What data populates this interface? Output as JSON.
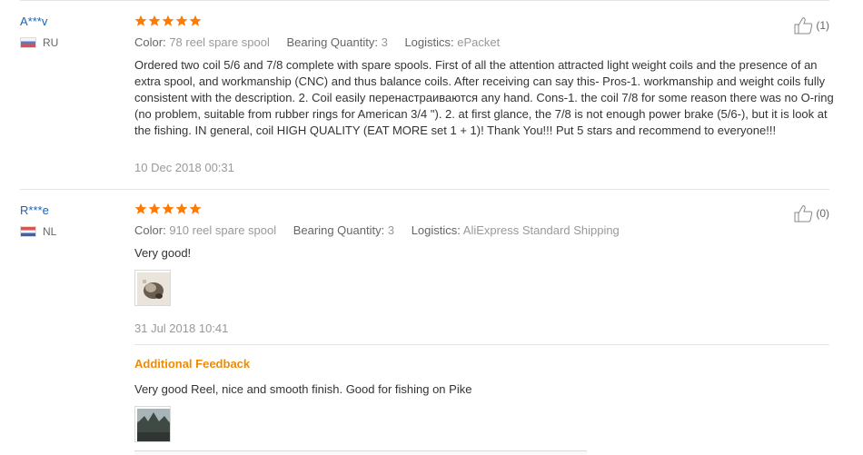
{
  "reviews": [
    {
      "user": "A***v",
      "country": "RU",
      "rating": 5,
      "attributes": [
        {
          "label": "Color:",
          "value": "78 reel spare spool"
        },
        {
          "label": "Bearing Quantity:",
          "value": "3"
        },
        {
          "label": "Logistics:",
          "value": "ePacket"
        }
      ],
      "text": "Ordered two coil 5/6 and 7/8 complete with spare spools. First of all the attention attracted light weight coils and the presence of an extra spool, and workmanship (CNC) and thus balance coils. After receiving can say this- Pros-1. workmanship and weight coils fully consistent with the description. 2. Coil easily перенастраиваются any hand. Cons-1. the coil 7/8 for some reason there was no O-ring (no problem, suitable from rubber rings for American 3/4 \"). 2. at first glance, the 7/8 is not enough power brake (5/6-), but it is look at the fishing. IN general, coil HIGH QUALITY (EAT MORE set 1 + 1)! Thank You!!! Put 5 stars and recommend to everyone!!!",
      "date": "10 Dec 2018 00:31",
      "helpful": "(1)"
    },
    {
      "user": "R***e",
      "country": "NL",
      "rating": 5,
      "attributes": [
        {
          "label": "Color:",
          "value": "910 reel spare spool"
        },
        {
          "label": "Bearing Quantity:",
          "value": "3"
        },
        {
          "label": "Logistics:",
          "value": "AliExpress Standard Shipping"
        }
      ],
      "text": "Very good!",
      "date": "31 Jul 2018 10:41",
      "helpful": "(0)",
      "additional": {
        "title": "Additional Feedback",
        "text": "Very good Reel, nice and smooth finish. Good for fishing on Pike"
      }
    }
  ],
  "colors": {
    "user_link": "#1a63b8",
    "star": "#ff7a00",
    "additional_title": "#f08a00",
    "muted": "#999999"
  },
  "icons": {
    "star": "star-icon",
    "helpful": "thumbs-up-icon"
  }
}
